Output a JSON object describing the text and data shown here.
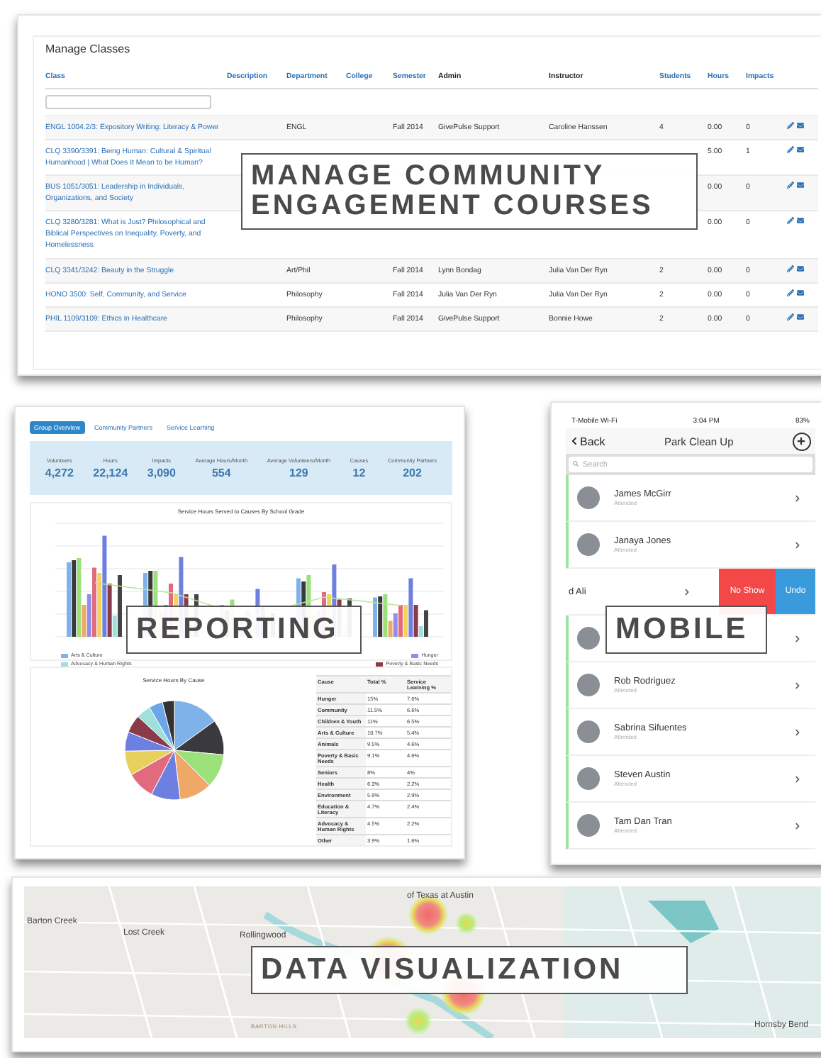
{
  "manage_classes": {
    "title": "Manage Classes",
    "columns": [
      {
        "label": "Class",
        "sortable": true
      },
      {
        "label": "Description",
        "sortable": true
      },
      {
        "label": "Department",
        "sortable": true
      },
      {
        "label": "College",
        "sortable": true
      },
      {
        "label": "Semester",
        "sortable": true
      },
      {
        "label": "Admin",
        "sortable": false
      },
      {
        "label": "Instructor",
        "sortable": false
      },
      {
        "label": "Students",
        "sortable": true
      },
      {
        "label": "Hours",
        "sortable": true
      },
      {
        "label": "Impacts",
        "sortable": true
      }
    ],
    "rows": [
      {
        "class": "ENGL 1004.2/3: Expository Writing: Literacy & Power",
        "department": "ENGL",
        "semester": "Fall 2014",
        "admin": "GivePulse Support",
        "instructor": "Caroline Hanssen",
        "students": "4",
        "hours": "0.00",
        "impacts": "0"
      },
      {
        "class": "CLQ 3390/3391: Being Human: Cultural & Spiritual Humanhood | What Does It Mean to be Human?",
        "hours": "5.00",
        "impacts": "1"
      },
      {
        "class": "BUS 1051/3051: Leadership in Individuals, Organizations, and Society",
        "hours": "0.00",
        "impacts": "0"
      },
      {
        "class": "CLQ 3280/3281: What is Just? Philosophical and Biblical Perspectives on Inequality, Poverty, and Homelessness",
        "hours": "0.00",
        "impacts": "0"
      },
      {
        "class": "CLQ 3341/3242: Beauty in the Struggle",
        "department": "Art/Phil",
        "semester": "Fall 2014",
        "admin": "Lynn Bondag",
        "instructor": "Julia Van Der Ryn",
        "students": "2",
        "hours": "0.00",
        "impacts": "0"
      },
      {
        "class": "HONO 3500: Self, Community, and Service",
        "department": "Philosophy",
        "semester": "Fall 2014",
        "admin": "Julia Van Der Ryn",
        "instructor": "Julia Van Der Ryn",
        "students": "2",
        "hours": "0.00",
        "impacts": "0"
      },
      {
        "class": "PHIL 1109/3109: Ethics in Healthcare",
        "department": "Philosophy",
        "semester": "Fall 2014",
        "admin": "GivePulse Support",
        "instructor": "Bonnie Howe",
        "students": "2",
        "hours": "0.00",
        "impacts": "0"
      }
    ],
    "overlay_label": "MANAGE COMMUNITY ENGAGEMENT COURSES"
  },
  "reporting": {
    "tabs": [
      {
        "label": "Group Overview",
        "selected": true
      },
      {
        "label": "Community Partners",
        "selected": false
      },
      {
        "label": "Service Learning",
        "selected": false
      }
    ],
    "stats": [
      {
        "label": "Volunteers",
        "value": "4,272"
      },
      {
        "label": "Hours",
        "value": "22,124"
      },
      {
        "label": "Impacts",
        "value": "3,090"
      },
      {
        "label": "Average Hours/Month",
        "value": "554"
      },
      {
        "label": "Average Volunteers/Month",
        "value": "129"
      },
      {
        "label": "Causes",
        "value": "12"
      },
      {
        "label": "Community Partners",
        "value": "202"
      }
    ],
    "bar_chart_title": "Service Hours Served to Causes By School Grade",
    "legend": [
      {
        "label": "Arts & Culture",
        "color": "#7fb2e8"
      },
      {
        "label": "Hunger",
        "color": "#8d8fe8"
      },
      {
        "label": "Advocacy & Human Rights",
        "color": "#9fe0dc"
      },
      {
        "label": "Poverty & Basic Needs",
        "color": "#8a3a48"
      }
    ],
    "pie_title": "Service Hours By Cause",
    "cause_columns": [
      "Cause",
      "Total %",
      "Service Learning %"
    ],
    "causes": [
      {
        "cause": "Hunger",
        "total": "15%",
        "service": "7.6%"
      },
      {
        "cause": "Community",
        "total": "11.5%",
        "service": "6.6%"
      },
      {
        "cause": "Children & Youth",
        "total": "11%",
        "service": "6.5%"
      },
      {
        "cause": "Arts & Culture",
        "total": "10.7%",
        "service": "5.4%"
      },
      {
        "cause": "Animals",
        "total": "9.5%",
        "service": "4.6%"
      },
      {
        "cause": "Poverty & Basic Needs",
        "total": "9.1%",
        "service": "4.6%"
      },
      {
        "cause": "Seniors",
        "total": "8%",
        "service": "4%"
      },
      {
        "cause": "Health",
        "total": "6.3%",
        "service": "2.2%"
      },
      {
        "cause": "Environment",
        "total": "5.9%",
        "service": "2.9%"
      },
      {
        "cause": "Education & Literacy",
        "total": "4.7%",
        "service": "2.4%"
      },
      {
        "cause": "Advocacy & Human Rights",
        "total": "4.5%",
        "service": "2.2%"
      },
      {
        "cause": "Other",
        "total": "3.9%",
        "service": "1.6%"
      }
    ],
    "overlay_label": "REPORTING"
  },
  "mobile": {
    "status_bar": {
      "carrier": "T-Mobile Wi-Fi",
      "time": "3:04 PM",
      "battery": "83%"
    },
    "back": "Back",
    "title": "Park Clean Up",
    "search": {
      "placeholder": "Search"
    },
    "people": [
      {
        "kind": "person",
        "name": "James McGirr",
        "status": "Attended"
      },
      {
        "kind": "person",
        "name": "Janaya Jones",
        "status": "Attended"
      },
      {
        "kind": "swiped",
        "name": "d Ali",
        "actions": [
          "No Show",
          "Undo"
        ]
      },
      {
        "kind": "covered"
      },
      {
        "kind": "person",
        "name": "Rob Rodriguez",
        "status": "Attended"
      },
      {
        "kind": "person",
        "name": "Sabrina Sifuentes",
        "status": "Attended"
      },
      {
        "kind": "person",
        "name": "Steven Austin",
        "status": "Attended"
      },
      {
        "kind": "person",
        "name": "Tam Dan Tran",
        "status": "Attended"
      }
    ],
    "overlay_label": "MOBILE"
  },
  "map": {
    "places": [
      {
        "label": "of Texas at Austin",
        "kind": "poi"
      },
      {
        "label": "Barton Creek",
        "kind": "place"
      },
      {
        "label": "Lost Creek",
        "kind": "place"
      },
      {
        "label": "Rollingwood",
        "kind": "place"
      },
      {
        "label": "BARTON HILLS",
        "kind": "district"
      },
      {
        "label": "Hornsby Bend",
        "kind": "place"
      }
    ],
    "overlay_label": "DATA VISUALIZATION"
  }
}
